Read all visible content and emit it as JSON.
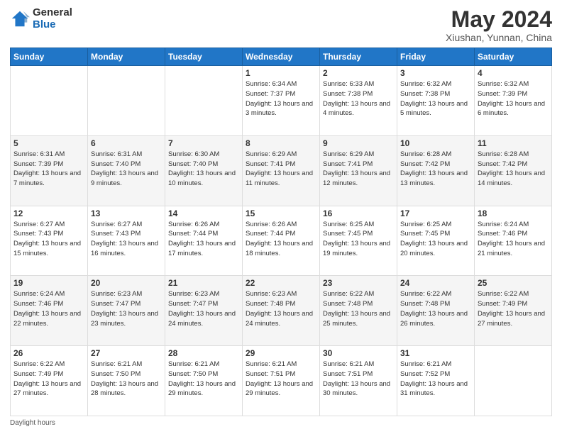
{
  "logo": {
    "general": "General",
    "blue": "Blue"
  },
  "title": "May 2024",
  "subtitle": "Xiushan, Yunnan, China",
  "days_of_week": [
    "Sunday",
    "Monday",
    "Tuesday",
    "Wednesday",
    "Thursday",
    "Friday",
    "Saturday"
  ],
  "footer": "Daylight hours",
  "weeks": [
    [
      {
        "day": "",
        "sunrise": "",
        "sunset": "",
        "daylight": ""
      },
      {
        "day": "",
        "sunrise": "",
        "sunset": "",
        "daylight": ""
      },
      {
        "day": "",
        "sunrise": "",
        "sunset": "",
        "daylight": ""
      },
      {
        "day": "1",
        "sunrise": "Sunrise: 6:34 AM",
        "sunset": "Sunset: 7:37 PM",
        "daylight": "Daylight: 13 hours and 3 minutes."
      },
      {
        "day": "2",
        "sunrise": "Sunrise: 6:33 AM",
        "sunset": "Sunset: 7:38 PM",
        "daylight": "Daylight: 13 hours and 4 minutes."
      },
      {
        "day": "3",
        "sunrise": "Sunrise: 6:32 AM",
        "sunset": "Sunset: 7:38 PM",
        "daylight": "Daylight: 13 hours and 5 minutes."
      },
      {
        "day": "4",
        "sunrise": "Sunrise: 6:32 AM",
        "sunset": "Sunset: 7:39 PM",
        "daylight": "Daylight: 13 hours and 6 minutes."
      }
    ],
    [
      {
        "day": "5",
        "sunrise": "Sunrise: 6:31 AM",
        "sunset": "Sunset: 7:39 PM",
        "daylight": "Daylight: 13 hours and 7 minutes."
      },
      {
        "day": "6",
        "sunrise": "Sunrise: 6:31 AM",
        "sunset": "Sunset: 7:40 PM",
        "daylight": "Daylight: 13 hours and 9 minutes."
      },
      {
        "day": "7",
        "sunrise": "Sunrise: 6:30 AM",
        "sunset": "Sunset: 7:40 PM",
        "daylight": "Daylight: 13 hours and 10 minutes."
      },
      {
        "day": "8",
        "sunrise": "Sunrise: 6:29 AM",
        "sunset": "Sunset: 7:41 PM",
        "daylight": "Daylight: 13 hours and 11 minutes."
      },
      {
        "day": "9",
        "sunrise": "Sunrise: 6:29 AM",
        "sunset": "Sunset: 7:41 PM",
        "daylight": "Daylight: 13 hours and 12 minutes."
      },
      {
        "day": "10",
        "sunrise": "Sunrise: 6:28 AM",
        "sunset": "Sunset: 7:42 PM",
        "daylight": "Daylight: 13 hours and 13 minutes."
      },
      {
        "day": "11",
        "sunrise": "Sunrise: 6:28 AM",
        "sunset": "Sunset: 7:42 PM",
        "daylight": "Daylight: 13 hours and 14 minutes."
      }
    ],
    [
      {
        "day": "12",
        "sunrise": "Sunrise: 6:27 AM",
        "sunset": "Sunset: 7:43 PM",
        "daylight": "Daylight: 13 hours and 15 minutes."
      },
      {
        "day": "13",
        "sunrise": "Sunrise: 6:27 AM",
        "sunset": "Sunset: 7:43 PM",
        "daylight": "Daylight: 13 hours and 16 minutes."
      },
      {
        "day": "14",
        "sunrise": "Sunrise: 6:26 AM",
        "sunset": "Sunset: 7:44 PM",
        "daylight": "Daylight: 13 hours and 17 minutes."
      },
      {
        "day": "15",
        "sunrise": "Sunrise: 6:26 AM",
        "sunset": "Sunset: 7:44 PM",
        "daylight": "Daylight: 13 hours and 18 minutes."
      },
      {
        "day": "16",
        "sunrise": "Sunrise: 6:25 AM",
        "sunset": "Sunset: 7:45 PM",
        "daylight": "Daylight: 13 hours and 19 minutes."
      },
      {
        "day": "17",
        "sunrise": "Sunrise: 6:25 AM",
        "sunset": "Sunset: 7:45 PM",
        "daylight": "Daylight: 13 hours and 20 minutes."
      },
      {
        "day": "18",
        "sunrise": "Sunrise: 6:24 AM",
        "sunset": "Sunset: 7:46 PM",
        "daylight": "Daylight: 13 hours and 21 minutes."
      }
    ],
    [
      {
        "day": "19",
        "sunrise": "Sunrise: 6:24 AM",
        "sunset": "Sunset: 7:46 PM",
        "daylight": "Daylight: 13 hours and 22 minutes."
      },
      {
        "day": "20",
        "sunrise": "Sunrise: 6:23 AM",
        "sunset": "Sunset: 7:47 PM",
        "daylight": "Daylight: 13 hours and 23 minutes."
      },
      {
        "day": "21",
        "sunrise": "Sunrise: 6:23 AM",
        "sunset": "Sunset: 7:47 PM",
        "daylight": "Daylight: 13 hours and 24 minutes."
      },
      {
        "day": "22",
        "sunrise": "Sunrise: 6:23 AM",
        "sunset": "Sunset: 7:48 PM",
        "daylight": "Daylight: 13 hours and 24 minutes."
      },
      {
        "day": "23",
        "sunrise": "Sunrise: 6:22 AM",
        "sunset": "Sunset: 7:48 PM",
        "daylight": "Daylight: 13 hours and 25 minutes."
      },
      {
        "day": "24",
        "sunrise": "Sunrise: 6:22 AM",
        "sunset": "Sunset: 7:48 PM",
        "daylight": "Daylight: 13 hours and 26 minutes."
      },
      {
        "day": "25",
        "sunrise": "Sunrise: 6:22 AM",
        "sunset": "Sunset: 7:49 PM",
        "daylight": "Daylight: 13 hours and 27 minutes."
      }
    ],
    [
      {
        "day": "26",
        "sunrise": "Sunrise: 6:22 AM",
        "sunset": "Sunset: 7:49 PM",
        "daylight": "Daylight: 13 hours and 27 minutes."
      },
      {
        "day": "27",
        "sunrise": "Sunrise: 6:21 AM",
        "sunset": "Sunset: 7:50 PM",
        "daylight": "Daylight: 13 hours and 28 minutes."
      },
      {
        "day": "28",
        "sunrise": "Sunrise: 6:21 AM",
        "sunset": "Sunset: 7:50 PM",
        "daylight": "Daylight: 13 hours and 29 minutes."
      },
      {
        "day": "29",
        "sunrise": "Sunrise: 6:21 AM",
        "sunset": "Sunset: 7:51 PM",
        "daylight": "Daylight: 13 hours and 29 minutes."
      },
      {
        "day": "30",
        "sunrise": "Sunrise: 6:21 AM",
        "sunset": "Sunset: 7:51 PM",
        "daylight": "Daylight: 13 hours and 30 minutes."
      },
      {
        "day": "31",
        "sunrise": "Sunrise: 6:21 AM",
        "sunset": "Sunset: 7:52 PM",
        "daylight": "Daylight: 13 hours and 31 minutes."
      },
      {
        "day": "",
        "sunrise": "",
        "sunset": "",
        "daylight": ""
      }
    ]
  ]
}
